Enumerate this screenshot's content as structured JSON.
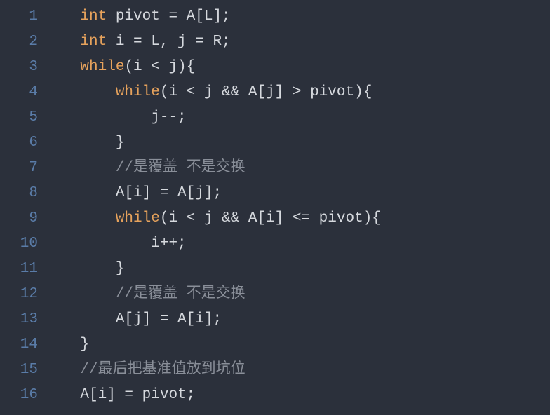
{
  "lines": [
    {
      "num": "1",
      "indent": "    ",
      "segments": [
        {
          "cls": "kw",
          "t": "int"
        },
        {
          "cls": "plain",
          "t": " pivot = A[L];"
        }
      ]
    },
    {
      "num": "2",
      "indent": "    ",
      "segments": [
        {
          "cls": "kw",
          "t": "int"
        },
        {
          "cls": "plain",
          "t": " i = L, j = R;"
        }
      ]
    },
    {
      "num": "3",
      "indent": "    ",
      "segments": [
        {
          "cls": "kw",
          "t": "while"
        },
        {
          "cls": "plain",
          "t": "(i < j){"
        }
      ]
    },
    {
      "num": "4",
      "indent": "        ",
      "segments": [
        {
          "cls": "kw",
          "t": "while"
        },
        {
          "cls": "plain",
          "t": "(i < j && A[j] > pivot){"
        }
      ]
    },
    {
      "num": "5",
      "indent": "            ",
      "segments": [
        {
          "cls": "plain",
          "t": "j--;"
        }
      ]
    },
    {
      "num": "6",
      "indent": "        ",
      "segments": [
        {
          "cls": "plain",
          "t": "}"
        }
      ]
    },
    {
      "num": "7",
      "indent": "        ",
      "segments": [
        {
          "cls": "comment",
          "t": "//是覆盖 不是交换"
        }
      ]
    },
    {
      "num": "8",
      "indent": "        ",
      "segments": [
        {
          "cls": "plain",
          "t": "A[i] = A[j];"
        }
      ]
    },
    {
      "num": "9",
      "indent": "        ",
      "segments": [
        {
          "cls": "kw",
          "t": "while"
        },
        {
          "cls": "plain",
          "t": "(i < j && A[i] <= pivot){"
        }
      ]
    },
    {
      "num": "10",
      "indent": "            ",
      "segments": [
        {
          "cls": "plain",
          "t": "i++;"
        }
      ]
    },
    {
      "num": "11",
      "indent": "        ",
      "segments": [
        {
          "cls": "plain",
          "t": "}"
        }
      ]
    },
    {
      "num": "12",
      "indent": "        ",
      "segments": [
        {
          "cls": "comment",
          "t": "//是覆盖 不是交换"
        }
      ]
    },
    {
      "num": "13",
      "indent": "        ",
      "segments": [
        {
          "cls": "plain",
          "t": "A[j] = A[i];"
        }
      ]
    },
    {
      "num": "14",
      "indent": "    ",
      "segments": [
        {
          "cls": "plain",
          "t": "}"
        }
      ]
    },
    {
      "num": "15",
      "indent": "    ",
      "segments": [
        {
          "cls": "comment",
          "t": "//最后把基准值放到坑位"
        }
      ]
    },
    {
      "num": "16",
      "indent": "    ",
      "segments": [
        {
          "cls": "plain",
          "t": "A[i] = pivot;"
        }
      ]
    }
  ]
}
